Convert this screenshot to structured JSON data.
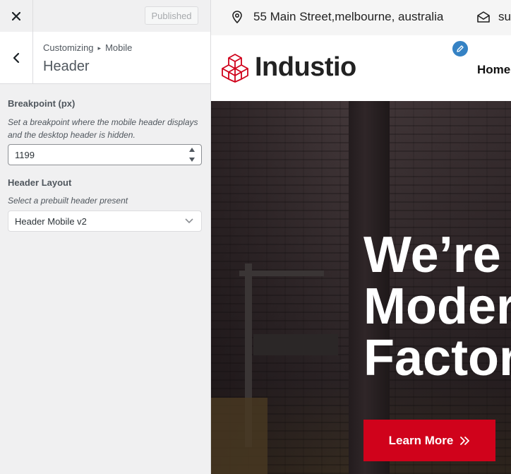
{
  "customizer": {
    "topbar": {
      "close_icon": "close-icon",
      "published_label": "Published"
    },
    "section": {
      "breadcrumb": [
        "Customizing",
        "Mobile"
      ],
      "title": "Header"
    },
    "breakpoint": {
      "label": "Breakpoint (px)",
      "description": "Set a breakpoint where the mobile header displays and the desktop header is hidden.",
      "value": "1199"
    },
    "header_layout": {
      "label": "Header Layout",
      "description": "Select a prebuilt header present",
      "selected": "Header Mobile v2"
    }
  },
  "preview": {
    "info_bar": {
      "address": "55 Main Street,melbourne, australia",
      "email_partial": "su"
    },
    "header": {
      "logo_text": "Industio",
      "nav_items": [
        "Home"
      ]
    },
    "hero": {
      "title_lines": [
        "We’re",
        "Moder",
        "Factor"
      ],
      "button_label": "Learn More"
    }
  },
  "colors": {
    "accent_red": "#d0021b",
    "edit_blue": "#3582c4",
    "sidebar_bg": "#f0f0f1"
  }
}
